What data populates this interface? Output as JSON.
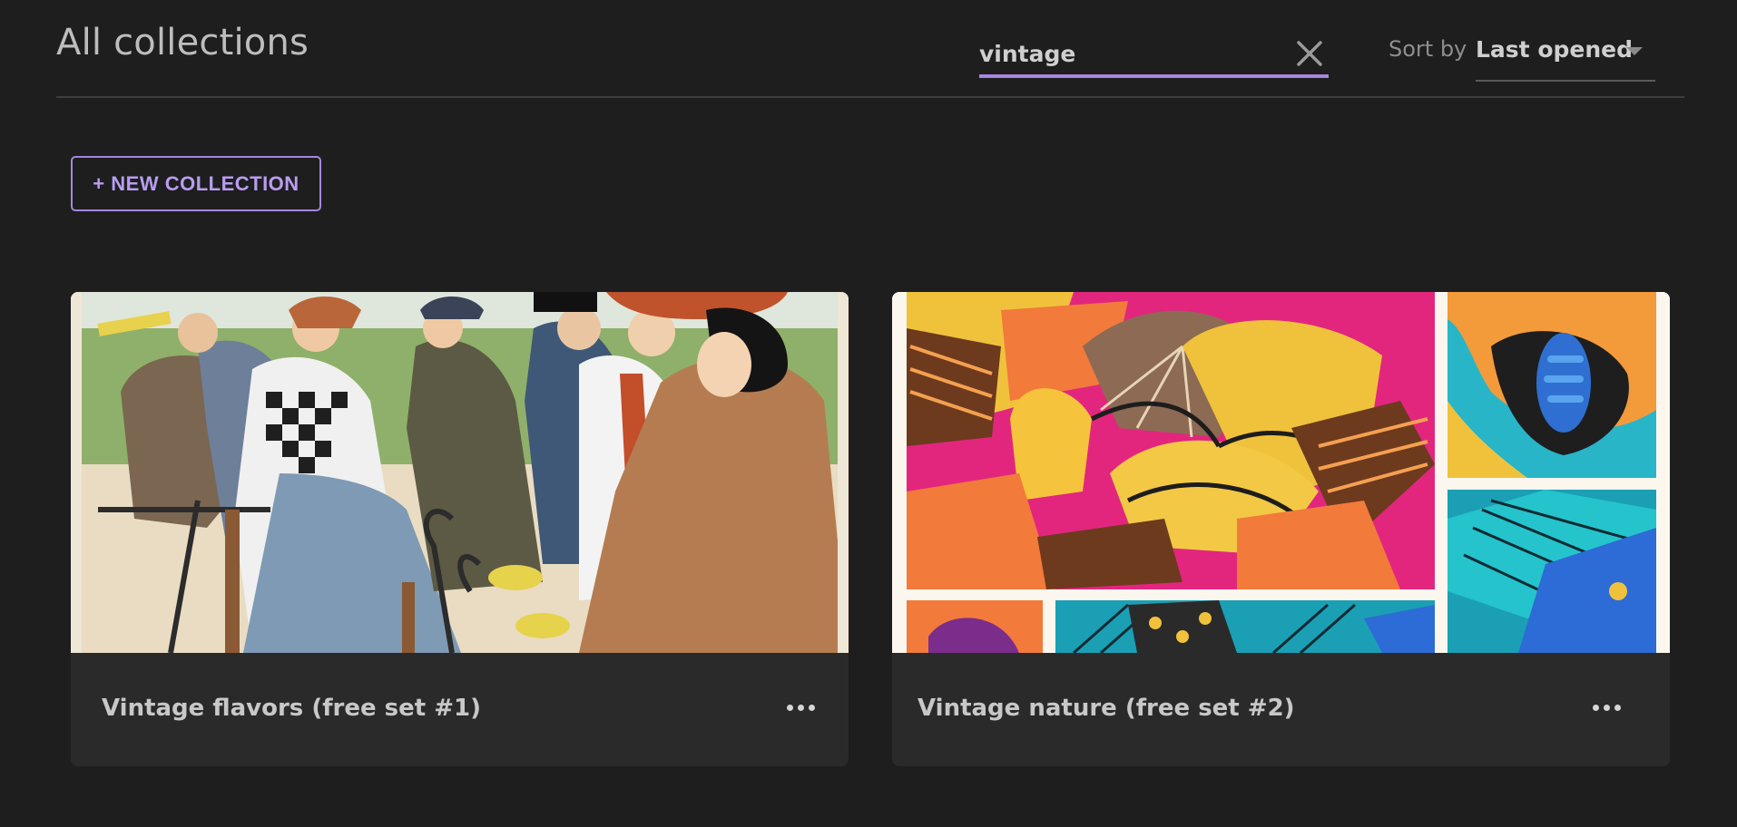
{
  "header": {
    "title": "All collections",
    "search": {
      "value": "vintage",
      "placeholder": ""
    },
    "sort": {
      "label": "Sort by",
      "value": "Last opened"
    }
  },
  "actions": {
    "new_collection_label": "+ NEW COLLECTION"
  },
  "collections": [
    {
      "title": "Vintage flavors (free set #1)",
      "image": "vintage-bicycle-riders-illustration"
    },
    {
      "title": "Vintage nature (free set #2)",
      "image": "art-deco-butterfly-pattern"
    }
  ],
  "colors": {
    "background": "#1e1e1e",
    "card": "#2a2a2a",
    "accent": "#a586e0"
  }
}
